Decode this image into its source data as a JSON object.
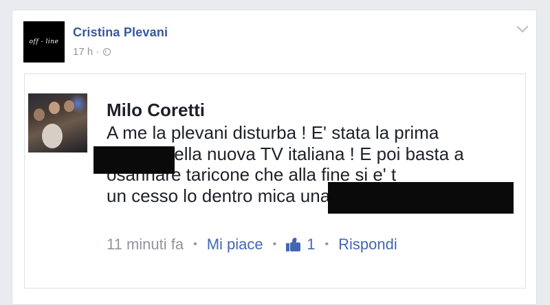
{
  "post": {
    "author": "Cristina Plevani",
    "avatar_text": "off - line",
    "time": "17 h",
    "separator": "·",
    "privacy_icon": "globe-icon",
    "menu_icon": "chevron-down-icon"
  },
  "comment": {
    "author": "Milo Coretti",
    "text": "A me la plevani disturba ! E' stata la prima\nzoco   a della nuova TV italiana ! E poi basta a\nosannare taricone che alla fine si e' t\nun cesso lo dentro mica una modella !!!",
    "time": "11 minuti fa",
    "like_label": "Mi piace",
    "likes": "1",
    "reply_label": "Rispondi",
    "dot": "•"
  },
  "colors": {
    "background": "#e9ebee",
    "link": "#4267b2",
    "author_link": "#365899",
    "meta": "#90949c",
    "text": "#1d2129"
  }
}
